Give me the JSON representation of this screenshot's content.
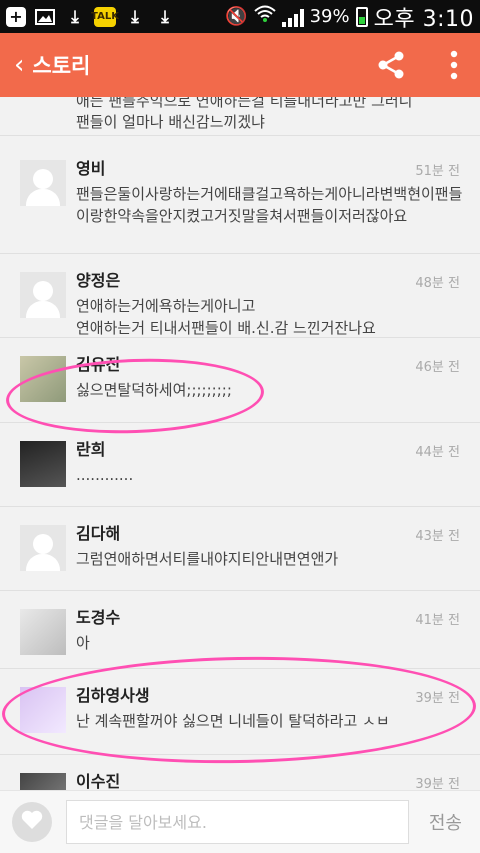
{
  "status_bar": {
    "battery": "39%",
    "time": "오후 3:10",
    "talk_badge": "TALK"
  },
  "app_bar": {
    "title": "스토리",
    "icons": [
      "back-chevron-icon",
      "share-icon",
      "more-vert-icon"
    ]
  },
  "partial_comment": {
    "line1": "애는 팬들주익으로 연애하는걸 티를내더라고만 그러니",
    "line2": "팬들이 얼마나 배신감느끼겠냐"
  },
  "comments": [
    {
      "author": "영비",
      "time": "51분 전",
      "text": "팬들은둘이사랑하는거에태클걸고욕하는게아니라변백현이팬들이랑한약속을안지켰고거짓말을쳐서팬들이저러잖아요",
      "avatar": "placeholder"
    },
    {
      "author": "양정은",
      "time": "48분 전",
      "text": "연애하는거에욕하는게아니고\n연애하는거 티내서팬들이 배.신.감 느낀거잔나요",
      "avatar": "placeholder"
    },
    {
      "author": "김유진",
      "time": "46분 전",
      "text": "싫으면탈덕하세여;;;;;;;;;",
      "avatar": "photo"
    },
    {
      "author": "란희",
      "time": "44분 전",
      "text": "............",
      "avatar": "photo"
    },
    {
      "author": "김다해",
      "time": "43분 전",
      "text": "그럼연애하면서티를내야지티안내면연앤가",
      "avatar": "placeholder"
    },
    {
      "author": "도경수",
      "time": "41분 전",
      "text": "아",
      "avatar": "photo"
    },
    {
      "author": "김하영사생",
      "time": "39분 전",
      "text": "난 계속팬할꺼야 싫으면 니네들이 탈덕하라고 ㅅㅂ",
      "avatar": "photo"
    },
    {
      "author": "이수진",
      "time": "39분 전",
      "text": "",
      "avatar": "photo"
    }
  ],
  "input_bar": {
    "placeholder": "댓글을 달아보세요.",
    "send_label": "전송"
  },
  "colors": {
    "accent": "#f26a4b",
    "annotation": "#ff4fb3"
  }
}
